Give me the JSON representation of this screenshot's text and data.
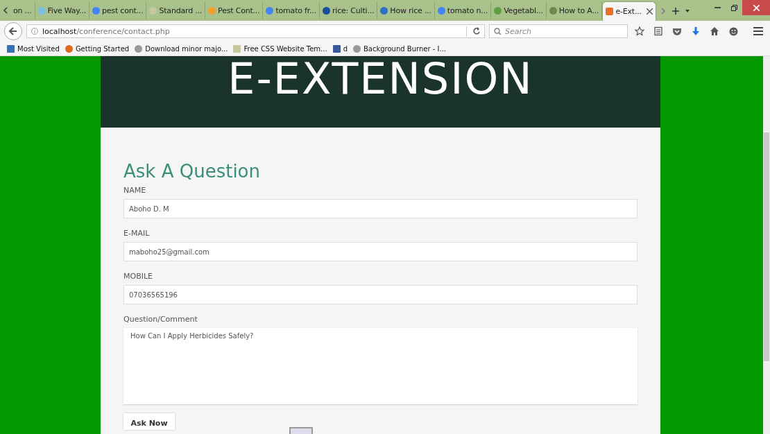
{
  "tabs": [
    {
      "label": "on ...",
      "selected": false
    },
    {
      "label": "Five Way...",
      "selected": false
    },
    {
      "label": "pest cont...",
      "selected": false
    },
    {
      "label": "Standard ...",
      "selected": false
    },
    {
      "label": "Pest Cont...",
      "selected": false
    },
    {
      "label": "tomato fr...",
      "selected": false
    },
    {
      "label": "rice: Culti...",
      "selected": false
    },
    {
      "label": "How rice ...",
      "selected": false
    },
    {
      "label": "tomato n...",
      "selected": false
    },
    {
      "label": "Vegetabl...",
      "selected": false
    },
    {
      "label": "How to A...",
      "selected": false
    },
    {
      "label": "e-Ext...",
      "selected": true
    }
  ],
  "address_bar": {
    "host": "localhost",
    "path": "/conference/contact.php"
  },
  "search": {
    "placeholder": "Search"
  },
  "bookmarks": [
    "Most Visited",
    "Getting Started",
    "Download minor majo...",
    "Free CSS Website Tem...",
    "d",
    "Background Burner - I..."
  ],
  "page": {
    "site_title": "E-EXTENSION",
    "heading": "Ask A Question",
    "fields": [
      {
        "label": "NAME",
        "value": "Aboho D. M",
        "kind": "input"
      },
      {
        "label": "E-MAIL",
        "value": "maboho25@gmail.com",
        "kind": "input"
      },
      {
        "label": "MOBILE",
        "value": "07036565196",
        "kind": "input"
      },
      {
        "label": "Question/Comment",
        "value": "How Can I Apply Herbicides Safely?",
        "kind": "textarea"
      }
    ],
    "submit": "Ask Now"
  }
}
